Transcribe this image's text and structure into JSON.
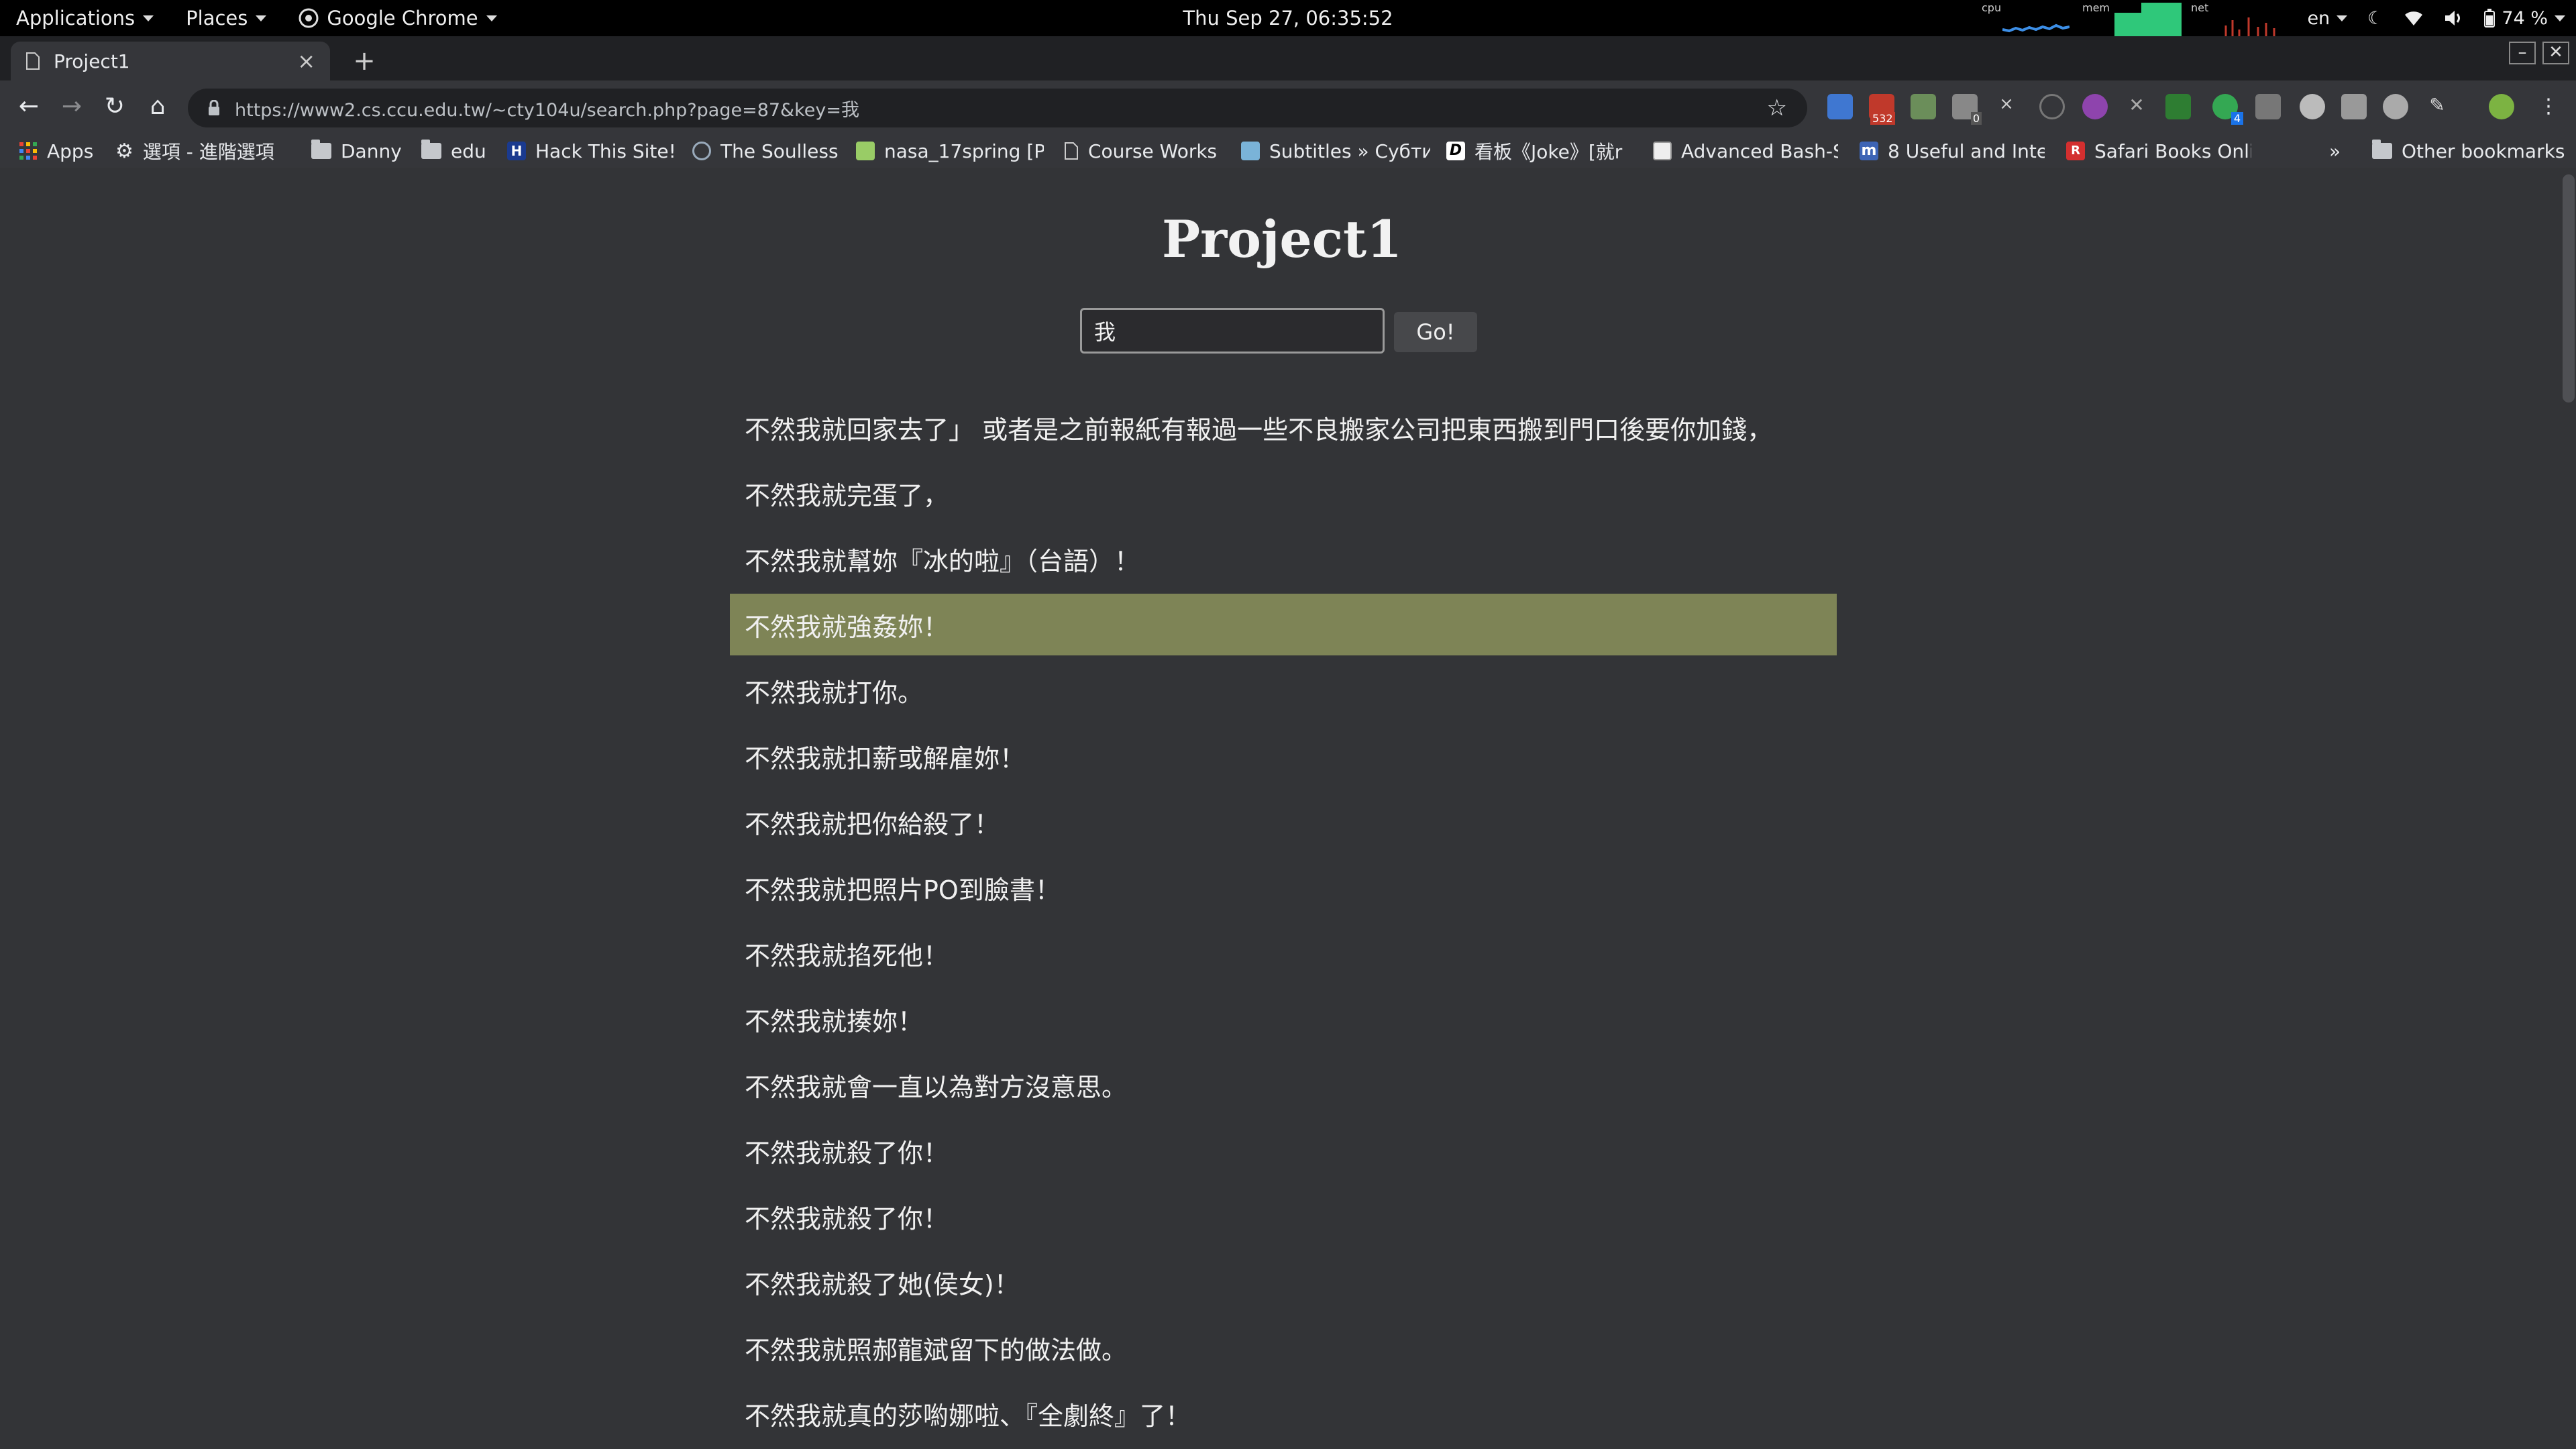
{
  "topbar": {
    "applications": "Applications",
    "places": "Places",
    "chrome_menu": "Google Chrome",
    "clock": "Thu Sep 27, 06:35:52",
    "cpu_label": "cpu",
    "mem_label": "mem",
    "net_label": "net",
    "lang": "en",
    "battery": "74 %"
  },
  "tab": {
    "title": "Project1",
    "close": "×",
    "new_tab": "+"
  },
  "window": {
    "minimize": "–",
    "close": "✕"
  },
  "toolbar": {
    "url": "https://www2.cs.ccu.edu.tw/~cty104u/search.php?page=87&key=我",
    "ext_badge_mail": "532",
    "ext_badge_zero": "0",
    "ext_badge_four": "4"
  },
  "bookmarks": [
    {
      "label": "Apps",
      "icon": "apps-grid-icon"
    },
    {
      "label": "選項 - 進階選項",
      "icon": "gear-icon"
    },
    {
      "label": "Danny",
      "icon": "folder-icon"
    },
    {
      "label": "edu",
      "icon": "folder-icon"
    },
    {
      "label": "Hack This Site!",
      "icon": "hack-this-site-icon"
    },
    {
      "label": "The Soulless",
      "icon": "soulless-icon"
    },
    {
      "label": "nasa_17spring [P",
      "icon": "nasa-icon"
    },
    {
      "label": "Course Works",
      "icon": "page-icon"
    },
    {
      "label": "Subtitles » Субти",
      "icon": "subtitles-icon"
    },
    {
      "label": "看板《Joke》[就r",
      "icon": "d-logo-icon"
    },
    {
      "label": "Advanced Bash-S",
      "icon": "bash-icon"
    },
    {
      "label": "8 Useful and Inte",
      "icon": "m-logo-icon"
    },
    {
      "label": "Safari Books Onli",
      "icon": "safari-books-icon"
    },
    {
      "label": "Other bookmarks",
      "icon": "folder-icon"
    }
  ],
  "bookmarks_overflow": "»",
  "page": {
    "heading": "Project1",
    "search_value": "我",
    "go_label": "Go!",
    "results": [
      "不然我就回家去了」 或者是之前報紙有報過一些不良搬家公司把東西搬到門口後要你加錢，",
      "不然我就完蛋了，",
      "不然我就幫妳『冰的啦』（台語）！",
      "不然我就強姦妳！",
      "不然我就打你。",
      "不然我就扣薪或解雇妳！",
      "不然我就把你給殺了！",
      "不然我就把照片PO到臉書！",
      "不然我就掐死他！",
      "不然我就揍妳！",
      "不然我就會一直以為對方沒意思。",
      "不然我就殺了你！",
      "不然我就殺了你！",
      "不然我就殺了她(侯女)！",
      "不然我就照郝龍斌留下的做法做。",
      "不然我就真的莎喲娜啦、『全劇終』了！"
    ],
    "highlight_color": "#7e8456"
  }
}
